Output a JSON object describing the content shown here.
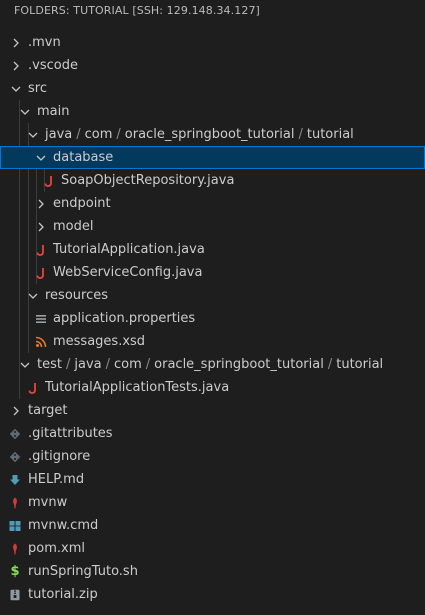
{
  "explorer": {
    "header": "FOLDERS: TUTORIAL [SSH: 129.148.34.127]"
  },
  "tree": {
    "mvn": ".mvn",
    "vscode": ".vscode",
    "src": "src",
    "main": "main",
    "java_path": [
      "java",
      "com",
      "oracle_springboot_tutorial",
      "tutorial"
    ],
    "database": "database",
    "soap_repo": "SoapObjectRepository.java",
    "endpoint": "endpoint",
    "model": "model",
    "tutorial_app": "TutorialApplication.java",
    "webservice_config": "WebServiceConfig.java",
    "resources": "resources",
    "app_props": "application.properties",
    "messages_xsd": "messages.xsd",
    "test_path": [
      "test",
      "java",
      "com",
      "oracle_springboot_tutorial",
      "tutorial"
    ],
    "tutorial_tests": "TutorialApplicationTests.java",
    "target": "target",
    "gitattributes": ".gitattributes",
    "gitignore": ".gitignore",
    "help_md": "HELP.md",
    "mvnw": "mvnw",
    "mvnw_cmd": "mvnw.cmd",
    "pom_xml": "pom.xml",
    "run_sh": "runSpringTuto.sh",
    "tutorial_zip": "tutorial.zip"
  },
  "colors": {
    "java": "#e8453c",
    "xml": "#e37933",
    "maven": "#d53b3b",
    "git": "#5f6b73",
    "markdown": "#519aba",
    "windows": "#519aba",
    "shell": "#89e051",
    "zip": "#8f9ba3",
    "selection": "#04395e"
  }
}
